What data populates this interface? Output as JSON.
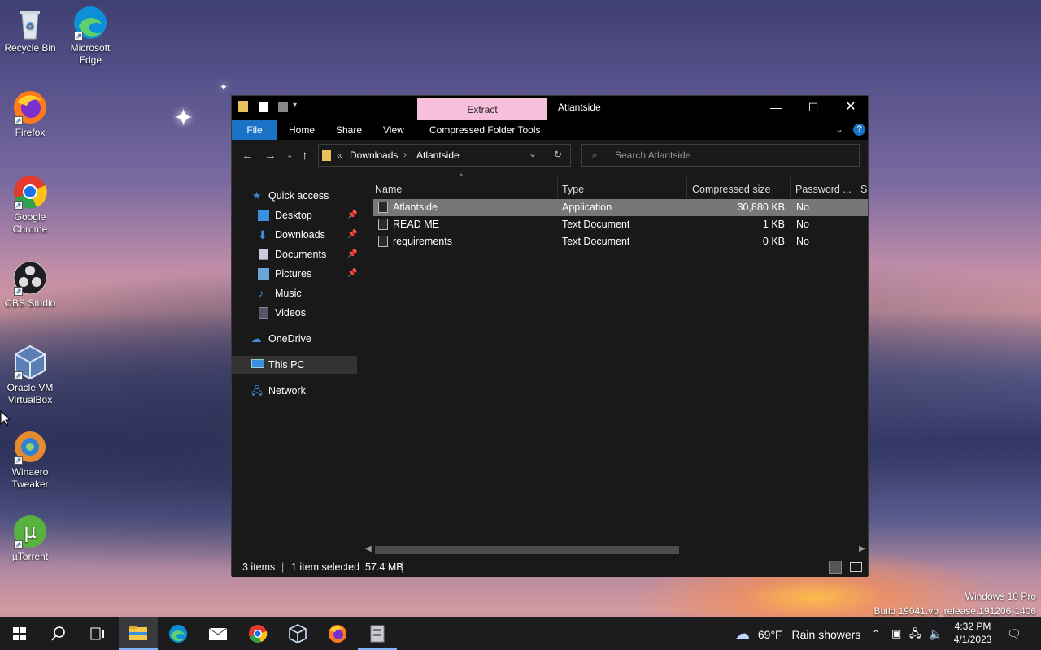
{
  "desktop": {
    "icons": [
      {
        "label": "Recycle Bin",
        "icon": "recycle-bin-icon"
      },
      {
        "label": "Microsoft Edge",
        "icon": "edge-icon"
      },
      {
        "label": "Firefox",
        "icon": "firefox-icon"
      },
      {
        "label": "Google Chrome",
        "icon": "chrome-icon"
      },
      {
        "label": "OBS Studio",
        "icon": "obs-icon"
      },
      {
        "label": "Oracle VM VirtualBox",
        "icon": "virtualbox-icon"
      },
      {
        "label": "Winaero Tweaker",
        "icon": "winaero-icon"
      },
      {
        "label": "µTorrent",
        "icon": "utorrent-icon"
      }
    ],
    "watermark": {
      "line1": "Windows 10 Pro",
      "line2": "Build 19041.vb_release.191206-1406"
    }
  },
  "explorer": {
    "title": "Atlantside",
    "context_tab": "Extract",
    "ribbon_tabs": [
      "File",
      "Home",
      "Share",
      "View",
      "Compressed Folder Tools"
    ],
    "breadcrumb": {
      "prefix": "«",
      "segments": [
        "Downloads",
        "Atlantside"
      ]
    },
    "search_placeholder": "Search Atlantside",
    "nav": {
      "quick_access": "Quick access",
      "items": [
        {
          "label": "Desktop",
          "pinned": true
        },
        {
          "label": "Downloads",
          "pinned": true
        },
        {
          "label": "Documents",
          "pinned": true
        },
        {
          "label": "Pictures",
          "pinned": true
        },
        {
          "label": "Music",
          "pinned": false
        },
        {
          "label": "Videos",
          "pinned": false
        }
      ],
      "onedrive": "OneDrive",
      "this_pc": "This PC",
      "network": "Network"
    },
    "columns": [
      "Name",
      "Type",
      "Compressed size",
      "Password ...",
      "Si"
    ],
    "files": [
      {
        "name": "Atlantside",
        "type": "Application",
        "size": "30,880 KB",
        "password": "No",
        "selected": true
      },
      {
        "name": "READ ME",
        "type": "Text Document",
        "size": "1 KB",
        "password": "No",
        "selected": false
      },
      {
        "name": "requirements",
        "type": "Text Document",
        "size": "0 KB",
        "password": "No",
        "selected": false
      }
    ],
    "status": {
      "items": "3 items",
      "selected": "1 item selected  57.4 MB"
    }
  },
  "taskbar": {
    "weather": {
      "temp": "69°F",
      "desc": "Rain showers"
    },
    "time": "4:32 PM",
    "date": "4/1/2023"
  },
  "colors": {
    "accent": "#1a73c7",
    "extract_tab": "#f7bfdc"
  }
}
